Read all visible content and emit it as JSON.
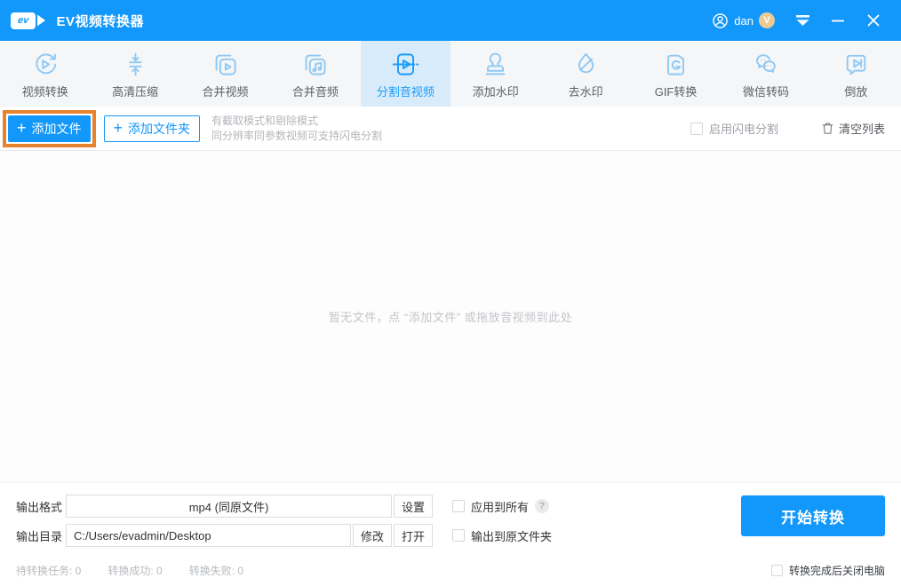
{
  "colors": {
    "brand": "#1297fa",
    "titlebar_bg": "#1297fa",
    "toolbar_bg": "#f5f6f8",
    "selected_tab_bg": "#d8ebfb",
    "selected_tab_color": "#1b9bf8",
    "tab_icon": "#8fc9f3",
    "tab_label": "#5c6066",
    "highlight_orange": "#e8832d",
    "badge_gold": "#eccb92",
    "hint_gray": "#b3b6bb",
    "empty_gray": "#c2c5c9",
    "status_gray": "#b7babe"
  },
  "titlebar": {
    "logo_text": "ev",
    "title": "EV视频转换器",
    "user_name": "dan",
    "user_badge": "V"
  },
  "toolbar": {
    "tabs": [
      {
        "label": "视频转换",
        "icon": "video-convert",
        "selected": false
      },
      {
        "label": "高清压缩",
        "icon": "hd-compress",
        "selected": false
      },
      {
        "label": "合并视频",
        "icon": "merge-video",
        "selected": false
      },
      {
        "label": "合并音频",
        "icon": "merge-audio",
        "selected": false
      },
      {
        "label": "分割音视频",
        "icon": "split-audio-video",
        "selected": true
      },
      {
        "label": "添加水印",
        "icon": "add-watermark",
        "selected": false
      },
      {
        "label": "去水印",
        "icon": "remove-watermark",
        "selected": false
      },
      {
        "label": "GIF转换",
        "icon": "gif-convert",
        "selected": false
      },
      {
        "label": "微信转码",
        "icon": "wechat-transcode",
        "selected": false
      },
      {
        "label": "倒放",
        "icon": "reverse-play",
        "selected": false
      }
    ]
  },
  "actionbar": {
    "plus": "+",
    "add_file_label": "添加文件",
    "add_folder_label": "添加文件夹",
    "hint_line1": "有截取模式和剔除模式",
    "hint_line2": "同分辨率同参数视频可支持闪电分割",
    "lightning_label": "启用闪电分割",
    "clear_label": "清空列表"
  },
  "filearea": {
    "empty_text": "暂无文件，点 “添加文件” 或拖放音视频到此处"
  },
  "output": {
    "format_label": "输出格式",
    "format_value": "mp4 (同原文件)",
    "settings_label": "设置",
    "apply_all_label": "应用到所有",
    "help_glyph": "?",
    "dir_label": "输出目录",
    "dir_value": "C:/Users/evadmin/Desktop",
    "modify_label": "修改",
    "open_label": "打开",
    "to_source_label": "输出到原文件夹",
    "start_label": "开始转换"
  },
  "statusbar": {
    "items": [
      "待转换任务: 0",
      "转换成功: 0",
      "转换失败: 0"
    ],
    "shutdown_label": "转换完成后关闭电脑"
  }
}
